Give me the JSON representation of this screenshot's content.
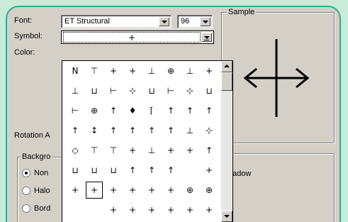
{
  "font": {
    "label": "Font:",
    "value": "ET Structural"
  },
  "size": {
    "value": "96"
  },
  "symbol": {
    "label": "Symbol:",
    "value": "+"
  },
  "color": {
    "label": "Color:"
  },
  "rotation": {
    "label": "Rotation A"
  },
  "background": {
    "title": "Backgro",
    "options": [
      {
        "label": "Non",
        "selected": true
      },
      {
        "label": "Halo",
        "selected": false
      },
      {
        "label": "Bord",
        "selected": false
      }
    ]
  },
  "sample": {
    "title": "Sample"
  },
  "shadow": {
    "label": "hadow"
  },
  "symbols": [
    [
      "N",
      "⊤",
      "+",
      "+",
      "⊥",
      "⊕",
      "⊥",
      "+"
    ],
    [
      "⊥",
      "⊔",
      "⊢",
      "⊹",
      "⊔",
      "⊢",
      "⊹",
      "⊔"
    ],
    [
      "⊢",
      "⊕",
      "↑",
      "♦",
      "⌈",
      "↑",
      "↑",
      "↑"
    ],
    [
      "↑",
      "↕",
      "↑",
      "↑",
      "↑",
      "↑",
      "⊥",
      "⊹"
    ],
    [
      "◇",
      "⊤",
      "⊤",
      "+",
      "⊥",
      "+",
      "+",
      "↑"
    ],
    [
      "⊔",
      "⊔",
      "⊔",
      "↑",
      "↑",
      "↑",
      "",
      "+"
    ],
    [
      "+",
      "+",
      "+",
      "+",
      "+",
      "+",
      "⊕",
      "⊕"
    ],
    [
      "",
      "",
      "+",
      "+",
      "+",
      "+",
      "+",
      "+"
    ]
  ],
  "selected_symbol": {
    "row": 6,
    "col": 1
  },
  "colors": {
    "panel_border": "#39a88e",
    "page_bg": "#c9ecd9",
    "dialog": "#d4d0c8"
  }
}
